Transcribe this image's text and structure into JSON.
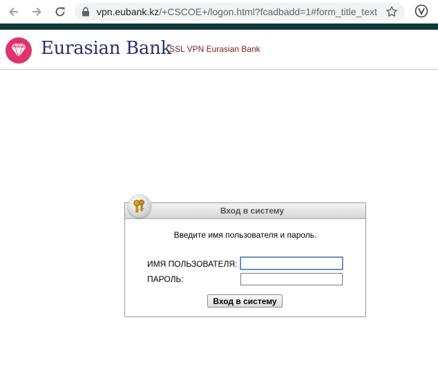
{
  "browser": {
    "url_host": "vpn.eubank.kz",
    "url_path": "/+CSCOE+/logon.html?fcadbadd=1#form_title_text"
  },
  "header": {
    "logo_text": "Eurasian Bank",
    "subtitle": "SSL VPN Eurasian Bank"
  },
  "login": {
    "title": "Вход в систему",
    "instruction": "Введите имя пользователя и пароль.",
    "username_label": "ИМЯ ПОЛЬЗОВАТЕЛЯ:",
    "password_label": "ПАРОЛЬ:",
    "username_value": "",
    "password_value": "",
    "submit_label": "Вход в систему"
  },
  "colors": {
    "brand_navy": "#2a3464",
    "brand_pink": "#e0336e",
    "subtitle_red": "#7a1a1a",
    "stripe": "#0f3a38"
  }
}
